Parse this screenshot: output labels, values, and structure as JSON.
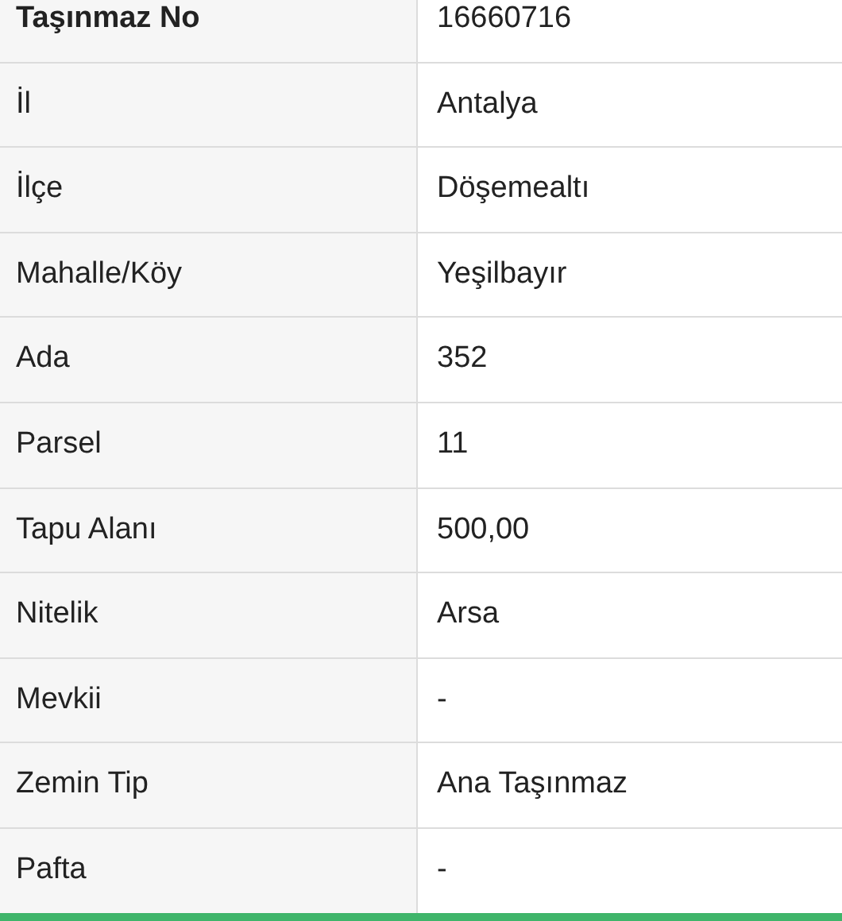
{
  "rows": [
    {
      "kind": "heading",
      "label": "Taşınmaz No",
      "value": "16660716"
    },
    {
      "kind": "field",
      "label": "İl",
      "value": "Antalya"
    },
    {
      "kind": "field",
      "label": "İlçe",
      "value": "Döşemealtı"
    },
    {
      "kind": "field",
      "label": "Mahalle/Köy",
      "value": "Yeşilbayır"
    },
    {
      "kind": "field",
      "label": "Ada",
      "value": "352"
    },
    {
      "kind": "field",
      "label": "Parsel",
      "value": "11"
    },
    {
      "kind": "field",
      "label": "Tapu Alanı",
      "value": "500,00"
    },
    {
      "kind": "field",
      "label": "Nitelik",
      "value": "Arsa"
    },
    {
      "kind": "field",
      "label": "Mevkii",
      "value": "-"
    },
    {
      "kind": "field",
      "label": "Zemin Tip",
      "value": "Ana Taşınmaz"
    },
    {
      "kind": "field",
      "label": "Pafta",
      "value": "-"
    }
  ]
}
